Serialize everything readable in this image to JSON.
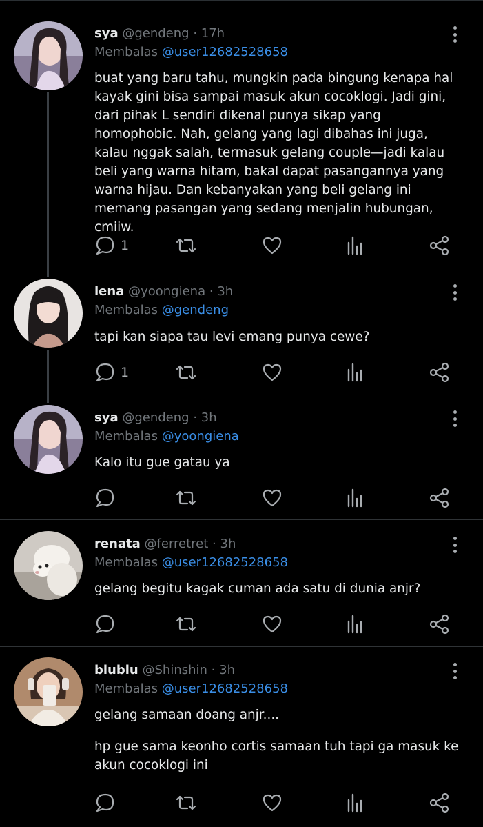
{
  "tweets": [
    {
      "name": "sya",
      "handle": "@gendeng",
      "dot": "·",
      "time": "17h",
      "reply_prefix": "Membalas",
      "reply_to": "@user12682528658",
      "paragraphs": [
        "buat yang baru tahu, mungkin pada bingung kenapa hal kayak gini bisa sampai masuk akun cocoklogi. Jadi gini, dari pihak L sendiri dikenal punya sikap yang homophobic. Nah, gelang yang lagi dibahas ini juga, kalau nggak salah, termasuk gelang couple—jadi kalau beli yang warna hitam, bakal dapat pasangannya yang warna hijau. Dan kebanyakan yang beli gelang ini memang pasangan yang sedang menjalin hubungan, cmiiw."
      ],
      "reply_count": "1"
    },
    {
      "name": "iena",
      "handle": "@yoongiena",
      "dot": "·",
      "time": "3h",
      "reply_prefix": "Membalas",
      "reply_to": "@gendeng",
      "paragraphs": [
        "tapi kan siapa tau levi emang punya cewe?"
      ],
      "reply_count": "1"
    },
    {
      "name": "sya",
      "handle": "@gendeng",
      "dot": "·",
      "time": "3h",
      "reply_prefix": "Membalas",
      "reply_to": "@yoongiena",
      "paragraphs": [
        "Kalo itu gue gatau ya"
      ],
      "reply_count": ""
    },
    {
      "name": "renata",
      "handle": "@ferretret",
      "dot": "·",
      "time": "3h",
      "reply_prefix": "Membalas",
      "reply_to": "@user12682528658",
      "paragraphs": [
        "gelang begitu kagak cuman ada satu di dunia anjr?"
      ],
      "reply_count": ""
    },
    {
      "name": "blublu",
      "handle": "@Shinshin",
      "dot": "·",
      "time": "3h",
      "reply_prefix": "Membalas",
      "reply_to": "@user12682528658",
      "paragraphs": [
        "gelang samaan doang anjr....",
        "hp gue sama keonho cortis samaan tuh tapi ga masuk ke akun cocoklogi ini"
      ],
      "reply_count": ""
    }
  ],
  "icons": {
    "reply": "speech-bubble-icon",
    "retweet": "retweet-arrows-icon",
    "like": "heart-outline-icon",
    "views": "bar-chart-icon",
    "share": "share-nodes-icon",
    "more": "vertical-ellipsis-icon"
  },
  "colors": {
    "background": "#000000",
    "text": "#e7e9ea",
    "muted": "#71767b",
    "mention": "#3a8ee6",
    "divider": "#2f3336"
  }
}
